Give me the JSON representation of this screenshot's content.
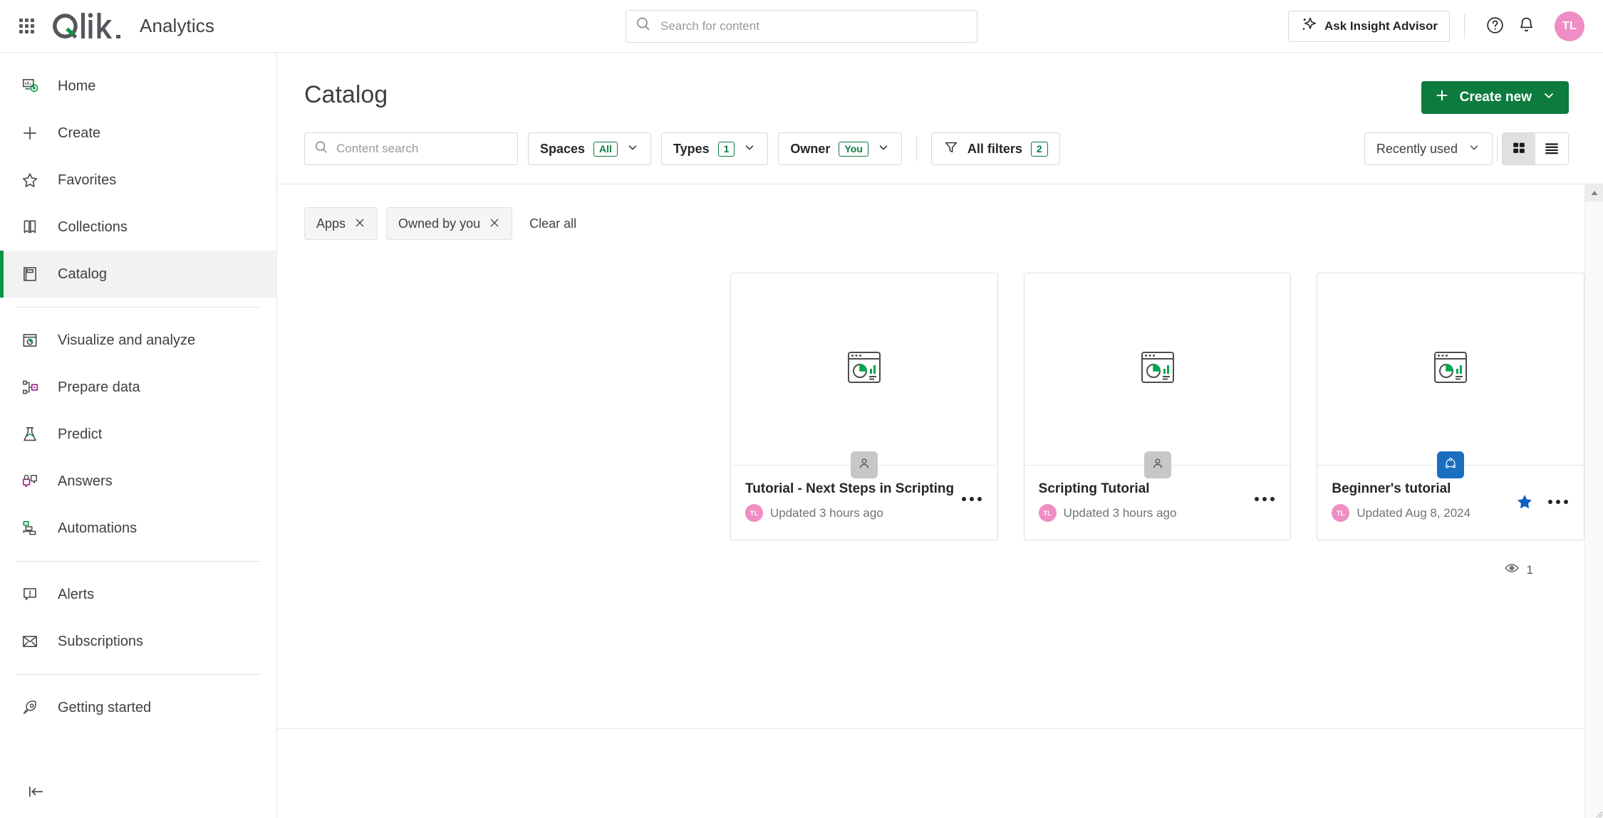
{
  "header": {
    "brand_name": "Qlik",
    "app_title": "Analytics",
    "search_placeholder": "Search for content",
    "search_value": "",
    "insight_advisor_label": "Ask Insight Advisor",
    "help_icon": "question-circle-icon",
    "notifications_icon": "bell-icon",
    "avatar_initials": "TL",
    "launcher_icon": "app-launcher-grid-icon"
  },
  "sidebar": {
    "groups": [
      {
        "items": [
          {
            "label": "Home",
            "icon": "home-dashboard-icon",
            "active": false
          },
          {
            "label": "Create",
            "icon": "plus-icon",
            "active": false
          },
          {
            "label": "Favorites",
            "icon": "star-outline-icon",
            "active": false
          },
          {
            "label": "Collections",
            "icon": "bookmark-icon",
            "active": false
          },
          {
            "label": "Catalog",
            "icon": "catalog-book-icon",
            "active": true
          }
        ]
      },
      {
        "items": [
          {
            "label": "Visualize and analyze",
            "icon": "visualize-window-icon",
            "active": false
          },
          {
            "label": "Prepare data",
            "icon": "prepare-data-nodes-icon",
            "active": false
          },
          {
            "label": "Predict",
            "icon": "flask-icon",
            "active": false
          },
          {
            "label": "Answers",
            "icon": "answers-chat-icon",
            "active": false
          },
          {
            "label": "Automations",
            "icon": "automations-flow-icon",
            "active": false
          }
        ]
      },
      {
        "items": [
          {
            "label": "Alerts",
            "icon": "alert-bubble-icon",
            "active": false
          },
          {
            "label": "Subscriptions",
            "icon": "envelope-icon",
            "active": false
          }
        ]
      },
      {
        "items": [
          {
            "label": "Getting started",
            "icon": "rocket-icon",
            "active": false
          }
        ]
      }
    ],
    "collapse_icon": "collapse-left-icon"
  },
  "page": {
    "title": "Catalog",
    "create_new_label": "Create new",
    "create_new_color": "#0d7b3e"
  },
  "toolbar": {
    "content_search_placeholder": "Content search",
    "content_search_value": "",
    "filters": [
      {
        "label": "Spaces",
        "badge": "All",
        "icon": "chevron-down-icon"
      },
      {
        "label": "Types",
        "badge": "1",
        "icon": "chevron-down-icon"
      },
      {
        "label": "Owner",
        "badge": "You",
        "icon": "chevron-down-icon"
      }
    ],
    "all_filters_label": "All filters",
    "all_filters_badge": "2",
    "all_filters_icon": "funnel-icon",
    "sort_label": "Recently used",
    "view_grid_icon": "grid-view-icon",
    "view_list_icon": "list-view-icon",
    "active_view": "grid",
    "badge_color": "#0d7b3e"
  },
  "chips": {
    "items": [
      {
        "label": "Apps"
      },
      {
        "label": "Owned by you"
      }
    ],
    "clear_all_label": "Clear all"
  },
  "cards": [
    {
      "title": "Tutorial - Next Steps in Scripting",
      "owner_initials": "TL",
      "updated": "Updated 3 hours ago",
      "thumb_icon": "app-chart-window-icon",
      "space_badge_icon": "personal-space-person-icon",
      "space_badge_type": "personal",
      "favorite": false,
      "more_icon": "more-horizontal-icon"
    },
    {
      "title": "Scripting Tutorial",
      "owner_initials": "TL",
      "updated": "Updated 3 hours ago",
      "thumb_icon": "app-chart-window-icon",
      "space_badge_icon": "personal-space-person-icon",
      "space_badge_type": "personal",
      "favorite": false,
      "more_icon": "more-horizontal-icon"
    },
    {
      "title": "Beginner's tutorial",
      "owner_initials": "TL",
      "updated": "Updated Aug 8, 2024",
      "thumb_icon": "app-chart-window-icon",
      "space_badge_icon": "shared-space-icon",
      "space_badge_type": "shared",
      "favorite": true,
      "more_icon": "more-horizontal-icon"
    }
  ],
  "footer": {
    "views_icon": "eye-icon",
    "views_count": "1"
  }
}
